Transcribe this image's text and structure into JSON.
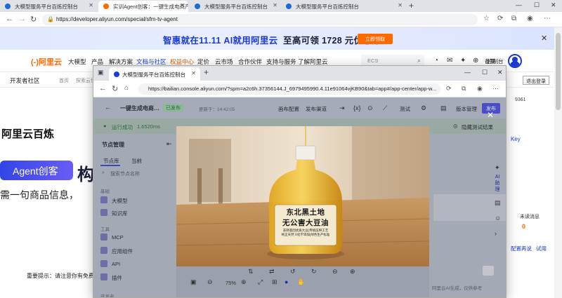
{
  "outer_browser": {
    "tabs": [
      {
        "title": "大模型服务平台百炼控制台",
        "active": false
      },
      {
        "title": "实训Agent创客：一键生成电商产品",
        "active": true
      },
      {
        "title": "大模型服务平台百炼控制台",
        "active": false
      },
      {
        "title": "大模型服务平台百炼控制台",
        "active": false
      }
    ],
    "url": "https://developer.aliyun.com/special/sfm-tv-agent"
  },
  "banner": {
    "text_blue": "智惠就在11.11 AI就用阿里云",
    "text_dark": "至高可领 1728 元优惠券",
    "button": "立即领取"
  },
  "site_header": {
    "logo": "阿里云",
    "nav": [
      "大模型",
      "产品",
      "解决方案",
      "文档与社区",
      "权益中心",
      "定价",
      "云市场",
      "合作伙伴",
      "支持与服务",
      "了解阿里云"
    ],
    "search_placeholder": "ECS",
    "beian": "备案",
    "console": "控制台"
  },
  "subbar": {
    "community": "开发者社区",
    "crumb1": "首页",
    "crumb2": "探索云世界",
    "logout": "退出登录"
  },
  "hero": {
    "title": "阿里云百炼",
    "badge": "Agent创客",
    "badge_tail": "构",
    "subtitle": "需一句商品信息，",
    "note": "重要提示：请注意你有免费额"
  },
  "right_panel": {
    "number": "9361",
    "key_link": "Key",
    "unread_label": "未读消息",
    "unread_value": "0",
    "other_value": "0",
    "link1": "配置再说",
    "link2": "试用"
  },
  "inner_browser": {
    "tab_title": "大模型服务平台百炼控制台",
    "url": "https://bailian.console.aliyun.com/?spm=a2c6h.37356144.J_6979495990.4.11e91064vjKB90&tab=app#/app-center/app-w..."
  },
  "app": {
    "title": "一键生成电商…",
    "published_badge": "已发布",
    "updated": "更新于：14:42:05",
    "canvas_config": "画布配置",
    "publish_channel": "发布渠道",
    "test": "测试",
    "version_mgmt": "版本管理",
    "publish_button": "发布",
    "run_status": "运行成功",
    "run_time": "1.6520ms",
    "hide_result": "隐藏测试结果",
    "node_mgmt": "节点管理",
    "tab_library": "节点库",
    "tab_current": "当前",
    "node_search_placeholder": "搜索节点名称",
    "section_basic": "基础",
    "node_llm": "大模型",
    "node_kb": "知识库",
    "section_tools": "工具",
    "node_mcp": "MCP",
    "node_app": "应用组件",
    "node_api": "API",
    "node_plugin": "插件",
    "section_other": "开发者",
    "zoom": "75%",
    "ai_help": "AI助理",
    "input_hint": "阿里云AI生成，仅供参考"
  },
  "image": {
    "label_line1": "东北黑土地",
    "label_line2": "无公害大豆油",
    "label_small1": "非转基因优质大豆",
    "label_small2": "传统压榨工艺",
    "label_small3": "纯正天然 0化学添加",
    "label_small4": "绿色生产标准"
  }
}
